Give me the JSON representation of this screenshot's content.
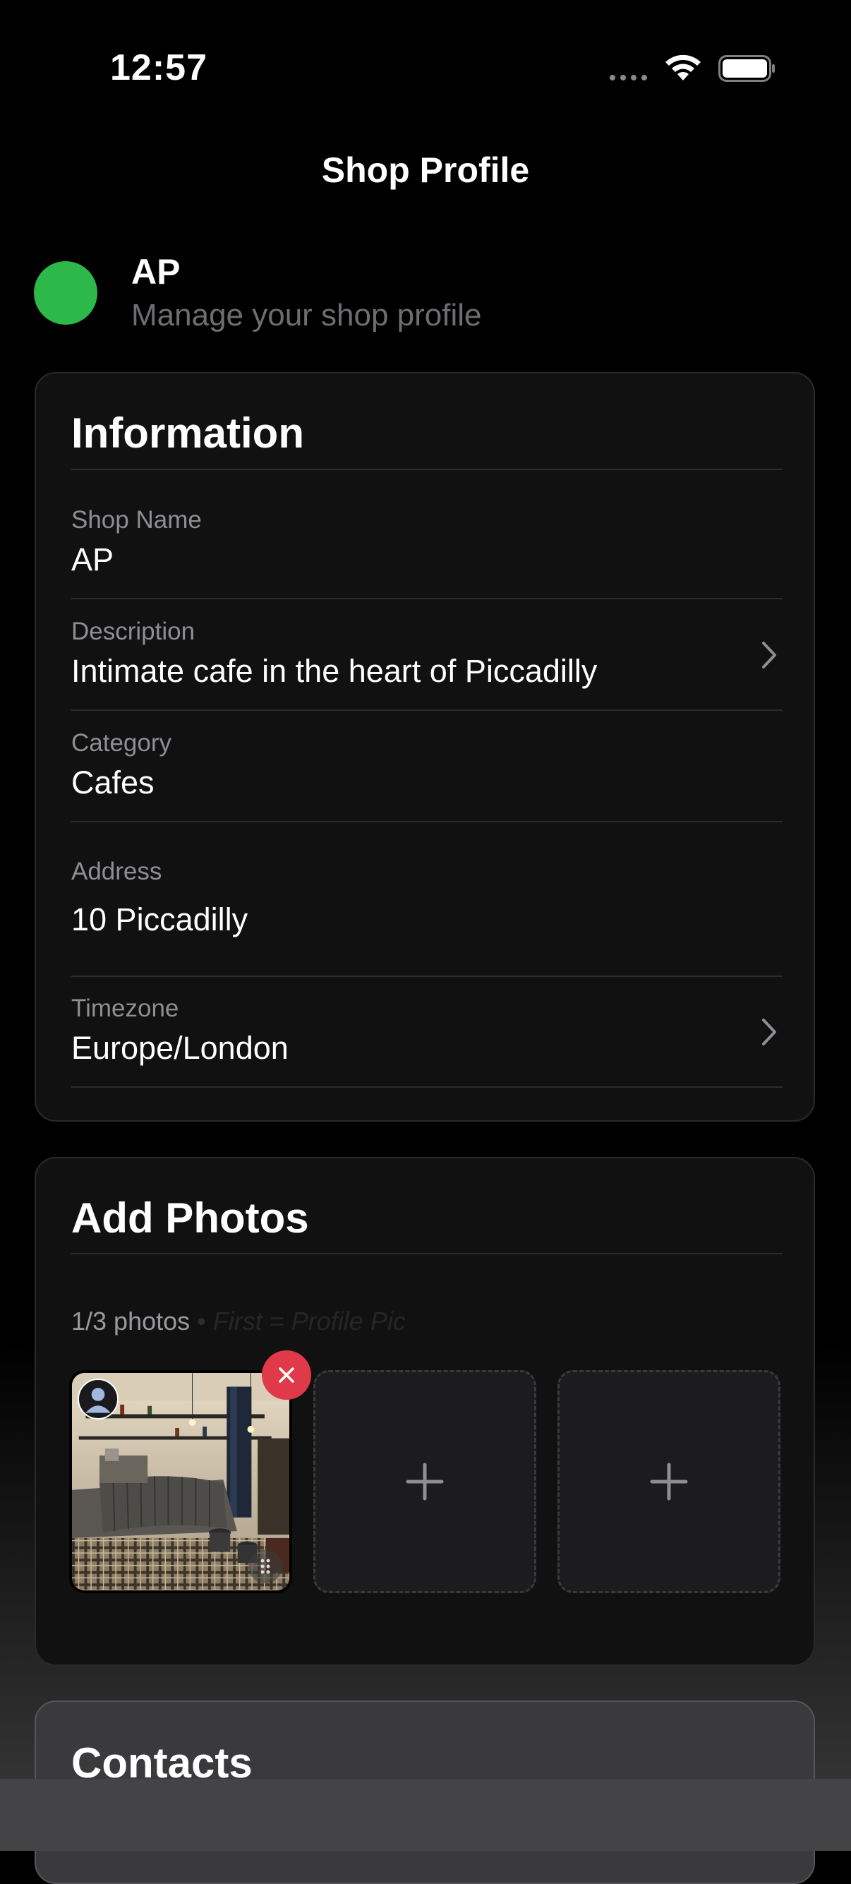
{
  "status_bar": {
    "time": "12:57"
  },
  "nav": {
    "title": "Shop Profile"
  },
  "header": {
    "avatar_color": "#2db84a",
    "name": "AP",
    "subtitle": "Manage your shop profile"
  },
  "information": {
    "title": "Information",
    "fields": [
      {
        "label": "Shop Name",
        "value": "AP"
      },
      {
        "label": "Description",
        "value": "Intimate cafe in the heart of Piccadilly"
      },
      {
        "label": "Category",
        "value": "Cafes"
      },
      {
        "label": "Address",
        "value": "10 Piccadilly"
      },
      {
        "label": "Timezone",
        "value": "Europe/London"
      }
    ]
  },
  "photos": {
    "title": "Add Photos",
    "count": "1/3 photos",
    "separator": "•",
    "hint": "First = Profile Pic",
    "slots": [
      {
        "state": "filled",
        "icon": "cafe-photo"
      },
      {
        "state": "empty",
        "icon": "plus-icon"
      },
      {
        "state": "empty",
        "icon": "plus-icon"
      }
    ]
  },
  "contacts": {
    "title": "Contacts"
  },
  "colors": {
    "background": "#000000",
    "card": "#111112",
    "accent_green": "#2db84a",
    "remove_red": "#e03a4a"
  }
}
